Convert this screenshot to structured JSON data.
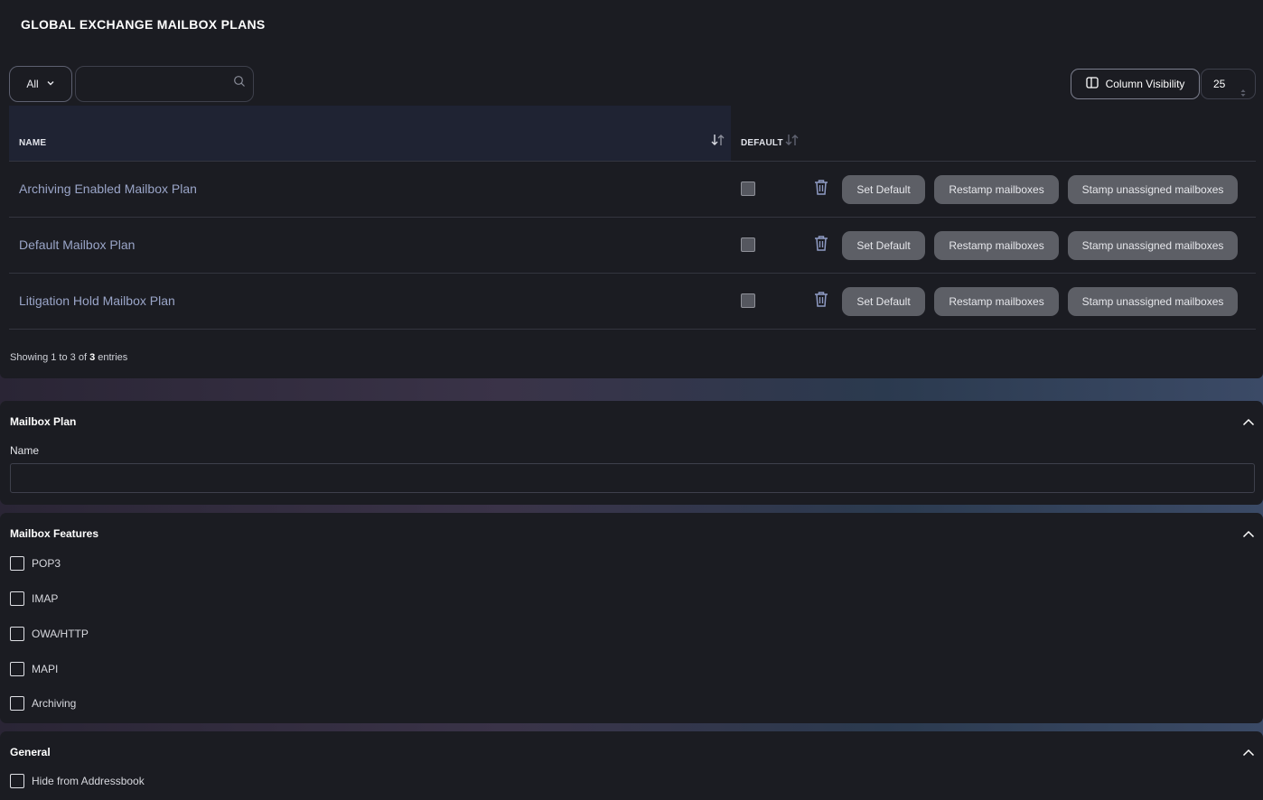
{
  "page": {
    "title": "GLOBAL EXCHANGE MAILBOX PLANS"
  },
  "toolbar": {
    "filter_value": "All",
    "search_value": "",
    "column_visibility_label": "Column Visibility",
    "page_size": "25"
  },
  "table": {
    "columns": [
      "NAME",
      "DEFAULT"
    ],
    "rows": [
      {
        "name": "Archiving Enabled Mailbox Plan",
        "default": false
      },
      {
        "name": "Default Mailbox Plan",
        "default": false
      },
      {
        "name": "Litigation Hold Mailbox Plan",
        "default": false
      }
    ],
    "actions": {
      "set_default": "Set Default",
      "restamp": "Restamp mailboxes",
      "stamp_unassigned": "Stamp unassigned mailboxes"
    },
    "info": {
      "prefix": "Showing 1 to 3 of ",
      "total": "3",
      "suffix": " entries"
    }
  },
  "mailbox_plan": {
    "title": "Mailbox Plan",
    "name_label": "Name",
    "name_value": ""
  },
  "mailbox_features": {
    "title": "Mailbox Features",
    "items": [
      {
        "label": "POP3",
        "checked": false
      },
      {
        "label": "IMAP",
        "checked": false
      },
      {
        "label": "OWA/HTTP",
        "checked": false
      },
      {
        "label": "MAPI",
        "checked": false
      },
      {
        "label": "Archiving",
        "checked": false
      }
    ]
  },
  "general": {
    "title": "General",
    "items": [
      {
        "label": "Hide from Addressbook",
        "checked": false
      }
    ]
  },
  "colors": {
    "background": "#1b1c22",
    "header_bg": "#1f2333",
    "link_text": "#9aa5c8",
    "button_bg": "#5d5f66"
  }
}
